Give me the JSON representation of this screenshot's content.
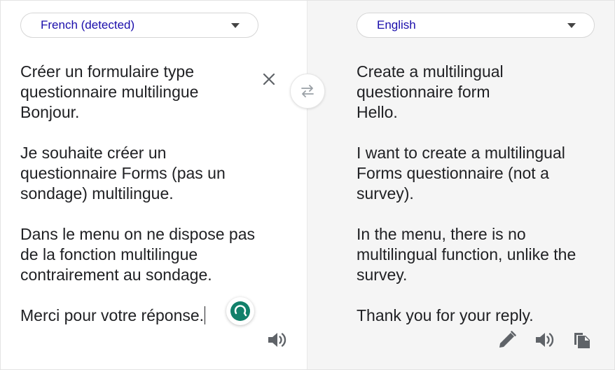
{
  "source": {
    "language_label": "French (detected)",
    "text": "Créer un formulaire type questionnaire multilingue\nBonjour.\n\nJe souhaite créer un questionnaire Forms (pas un sondage) multilingue.\n\nDans le menu on ne dispose pas de la fonction multilingue contrairement au sondage.\n\nMerci pour votre réponse."
  },
  "target": {
    "language_label": "English",
    "text": "Create a multilingual questionnaire form\nHello.\n\nI want to create a multilingual Forms questionnaire (not a survey).\n\nIn the menu, there is no multilingual function, unlike the survey.\n\nThank you for your reply."
  },
  "icons": {
    "clear": "close-icon",
    "swap": "swap-arrows-icon",
    "grammar": "grammar-assistant-icon",
    "listen_source": "speaker-icon",
    "edit": "pencil-icon",
    "listen_target": "speaker-icon",
    "copy": "copy-icon"
  },
  "colors": {
    "language_label": "#1a0dab",
    "text": "#202124",
    "icon": "#5f6368",
    "target_background": "#f5f5f5",
    "grammar_badge": "#11806a"
  }
}
